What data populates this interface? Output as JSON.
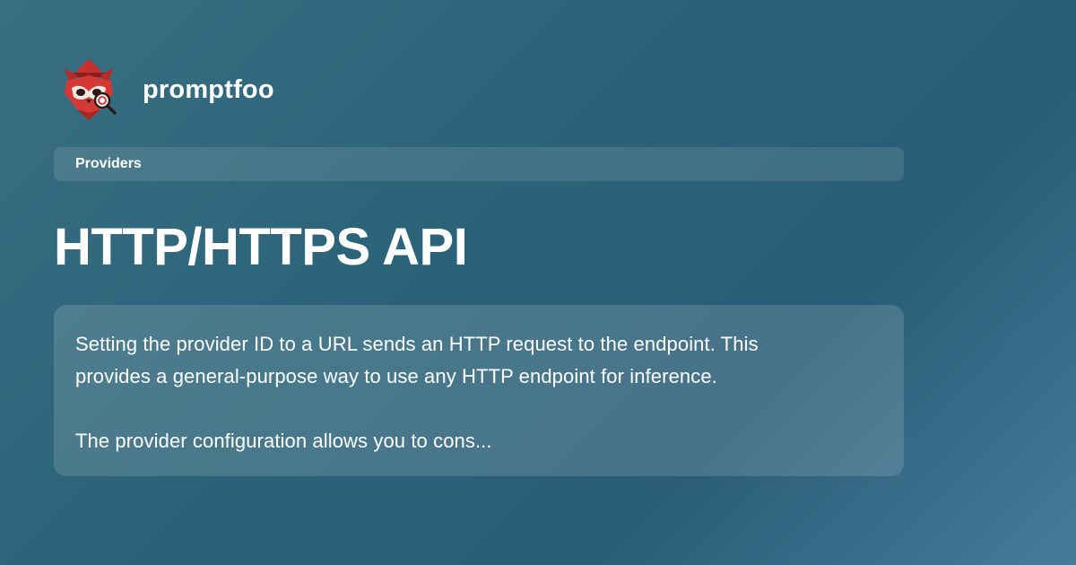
{
  "brand": {
    "name": "promptfoo",
    "logo_icon": "red-panda-detective-icon"
  },
  "breadcrumb": {
    "label": "Providers"
  },
  "page": {
    "title": "HTTP/HTTPS API",
    "description": {
      "line1": "Setting the provider ID to a URL sends an HTTP request to the endpoint. This",
      "line2": "provides a general-purpose way to use any HTTP endpoint for inference.",
      "line3": "The provider configuration allows you to cons..."
    }
  },
  "colors": {
    "background_start": "#3a6f82",
    "background_end": "#477b98",
    "logo_red": "#d43a35",
    "text": "#ffffff"
  }
}
